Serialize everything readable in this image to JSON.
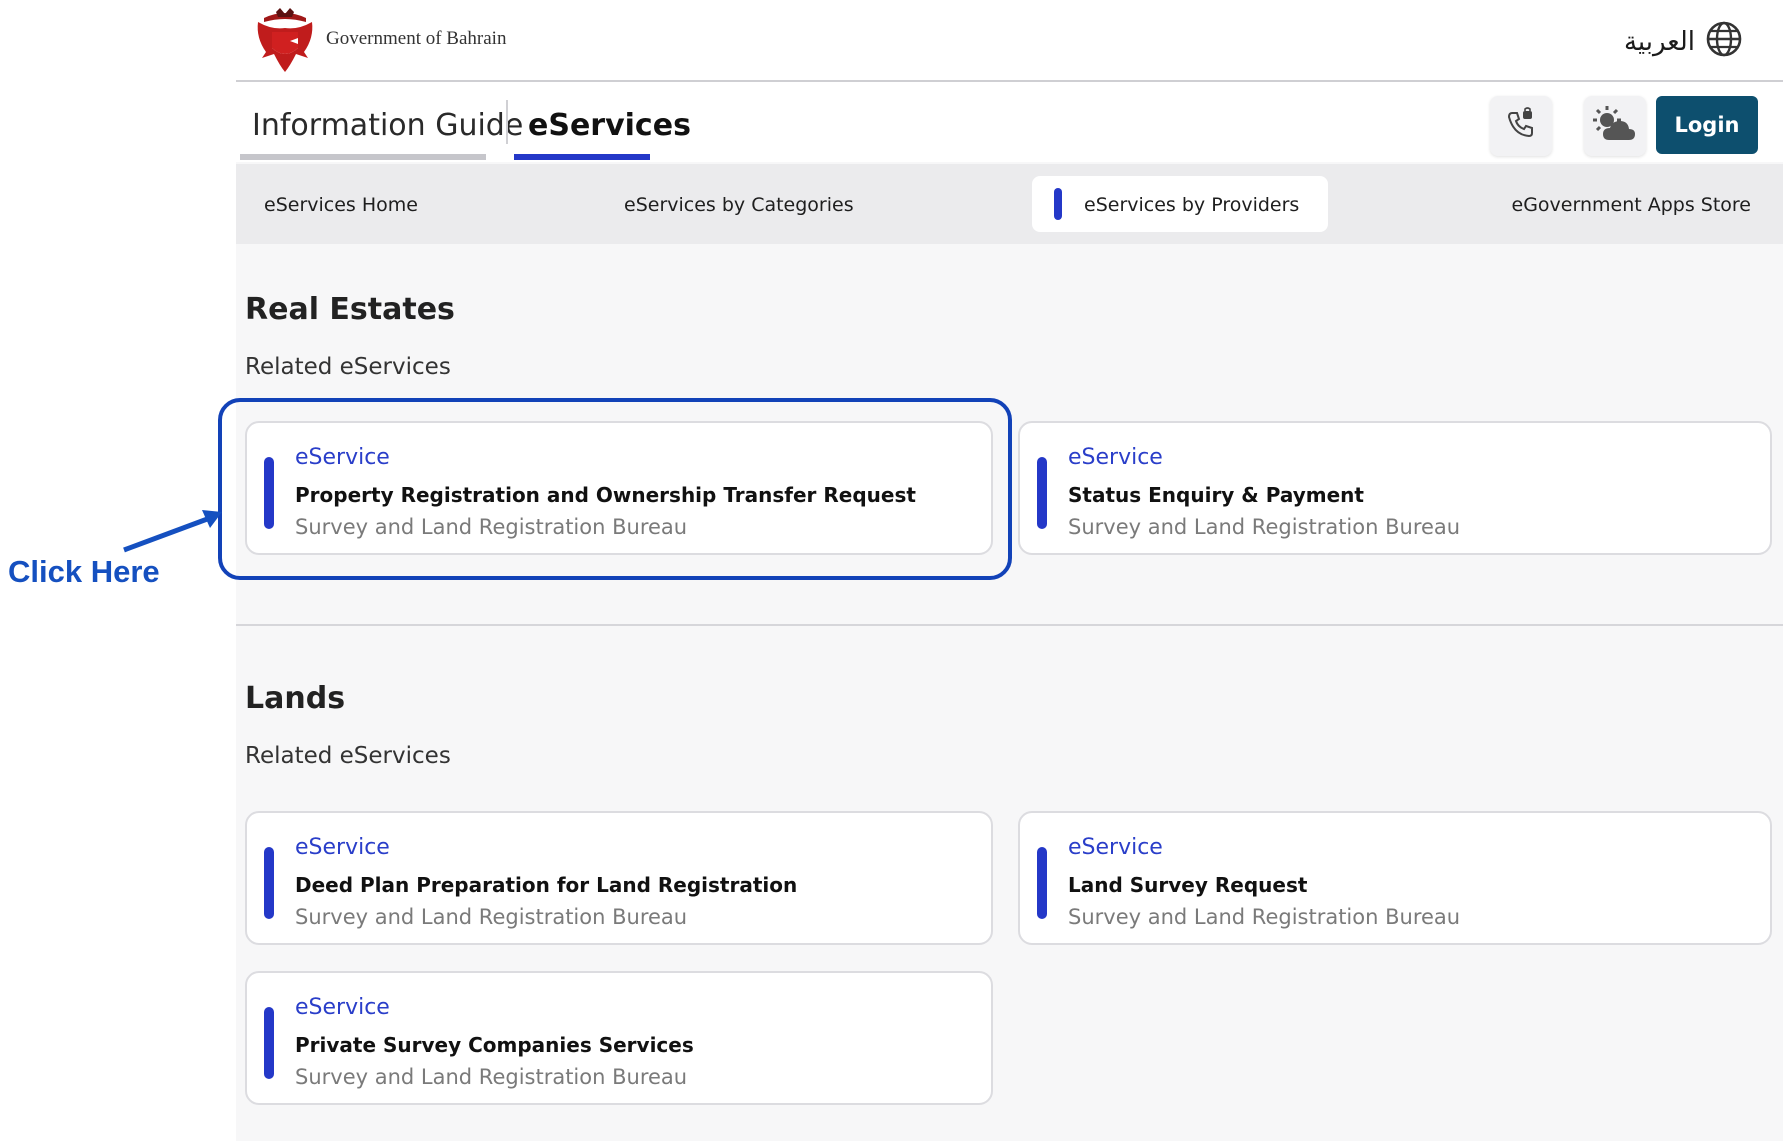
{
  "header": {
    "government_name": "Government of Bahrain",
    "language_label": "العربية"
  },
  "tabs": {
    "info_guide": "Information Guide",
    "eservices": "eServices",
    "login": "Login"
  },
  "subnav": {
    "home": "eServices Home",
    "categories": "eServices by Categories",
    "providers": "eServices by Providers",
    "apps_store": "eGovernment Apps Store"
  },
  "sections": [
    {
      "title": "Real Estates",
      "subtitle": "Related eServices",
      "cards": [
        {
          "type": "eService",
          "title": "Property Registration and Ownership Transfer Request",
          "provider": "Survey and Land Registration Bureau"
        },
        {
          "type": "eService",
          "title": "Status Enquiry & Payment",
          "provider": "Survey and Land Registration Bureau"
        }
      ]
    },
    {
      "title": "Lands",
      "subtitle": "Related eServices",
      "cards": [
        {
          "type": "eService",
          "title": "Deed Plan Preparation for Land Registration",
          "provider": "Survey and Land Registration Bureau"
        },
        {
          "type": "eService",
          "title": "Land Survey Request",
          "provider": "Survey and Land Registration Bureau"
        },
        {
          "type": "eService",
          "title": "Private Survey Companies Services",
          "provider": "Survey and Land Registration Bureau"
        }
      ]
    }
  ],
  "annotation": {
    "label": "Click Here"
  },
  "colors": {
    "accent": "#2438c8",
    "login_bg": "#0d4f6e",
    "annotation": "#1550c0"
  },
  "icons": {
    "emblem": "bahrain-emblem",
    "language": "globe-icon",
    "call": "phone-call-icon",
    "weather": "weather-icon"
  }
}
